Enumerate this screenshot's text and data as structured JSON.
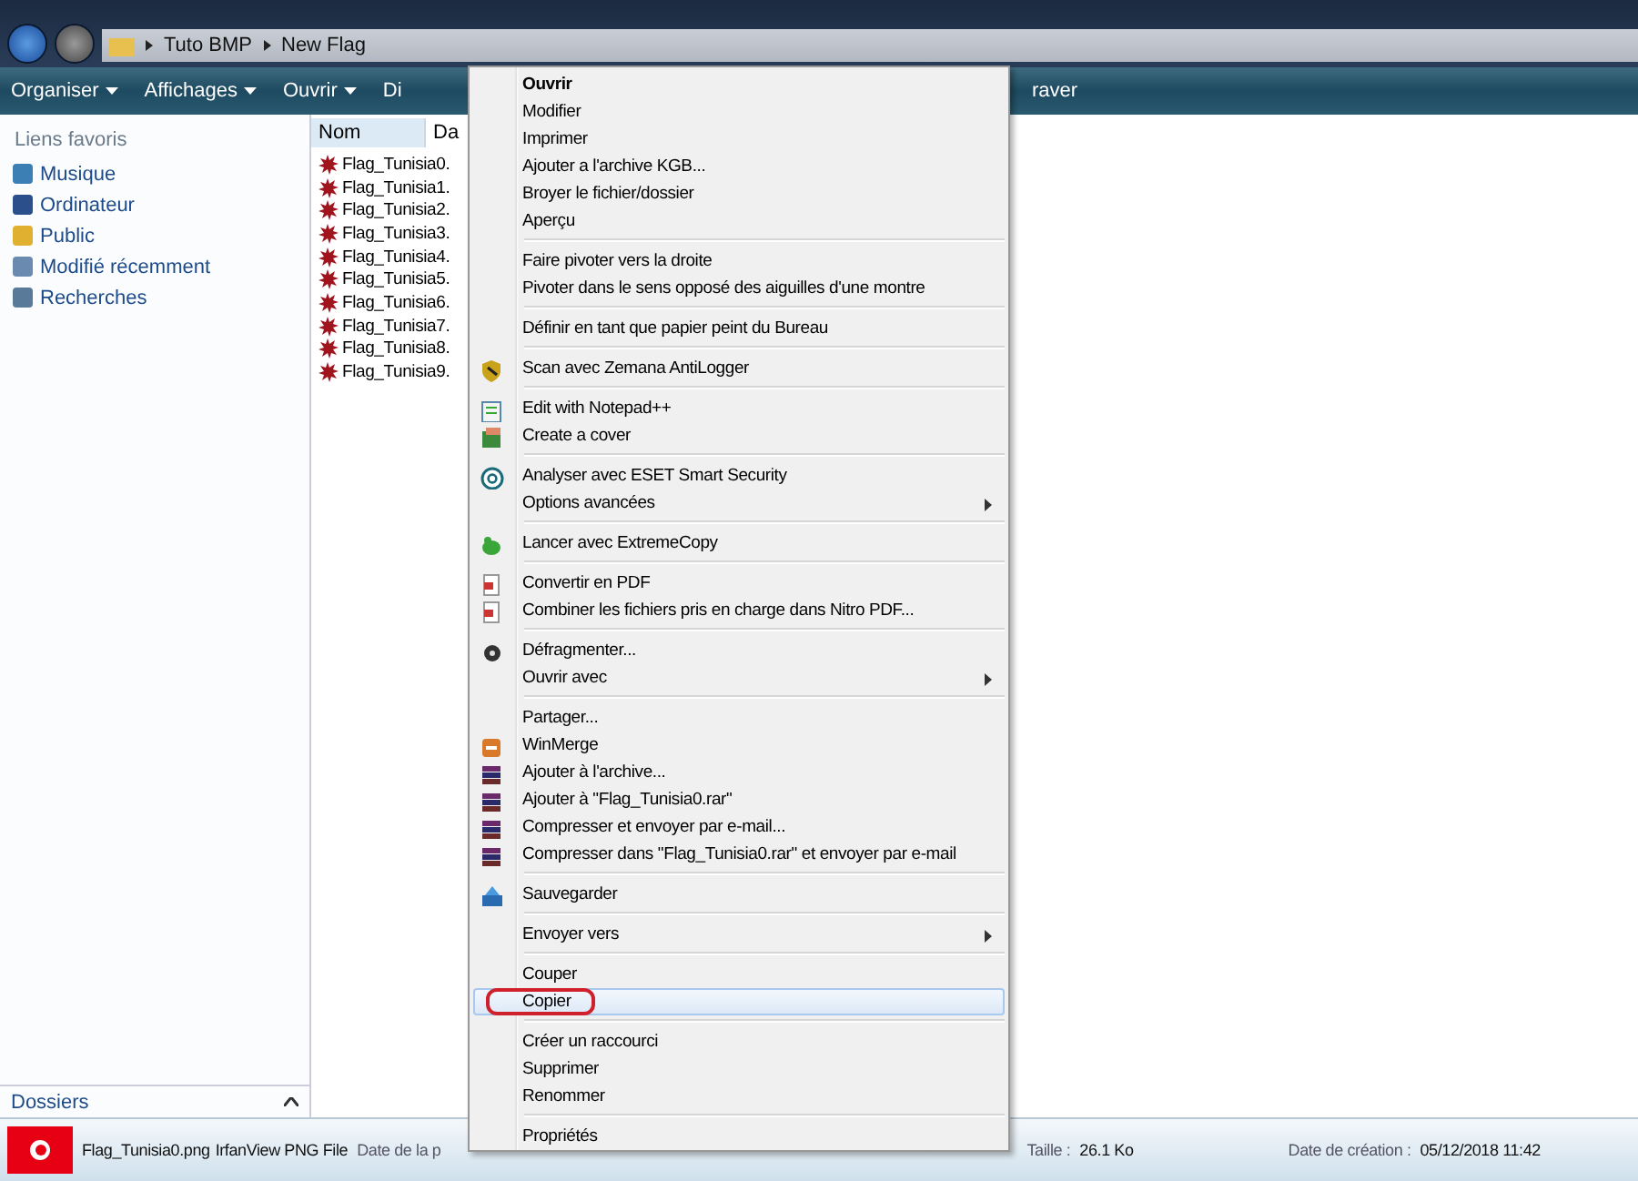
{
  "address_bar": {
    "crumbs": [
      "Tuto BMP",
      "New Flag"
    ]
  },
  "toolbar": {
    "items": [
      {
        "label": "Organiser",
        "kind": "dropdown"
      },
      {
        "label": "Affichages",
        "kind": "dropdown"
      },
      {
        "label": "Ouvrir",
        "kind": "dropdown"
      },
      {
        "label": "Di",
        "kind": "plain"
      }
    ],
    "trailing": "raver"
  },
  "sidebar": {
    "heading": "Liens favoris",
    "items": [
      {
        "label": "Musique"
      },
      {
        "label": "Ordinateur"
      },
      {
        "label": "Public"
      },
      {
        "label": "Modifié récemment"
      },
      {
        "label": "Recherches"
      }
    ],
    "folders": "Dossiers"
  },
  "file_list": {
    "columns": [
      "Nom",
      "Da"
    ],
    "files": [
      "Flag_Tunisia0.",
      "Flag_Tunisia1.",
      "Flag_Tunisia2.",
      "Flag_Tunisia3.",
      "Flag_Tunisia4.",
      "Flag_Tunisia5.",
      "Flag_Tunisia6.",
      "Flag_Tunisia7.",
      "Flag_Tunisia8.",
      "Flag_Tunisia9."
    ]
  },
  "context_menu": {
    "items": [
      {
        "kind": "item",
        "label": "Ouvrir",
        "bold": true,
        "icon": false,
        "submenu": false,
        "selected": false
      },
      {
        "kind": "item",
        "label": "Modifier",
        "bold": false,
        "icon": false,
        "submenu": false,
        "selected": false
      },
      {
        "kind": "item",
        "label": "Imprimer",
        "bold": false,
        "icon": false,
        "submenu": false,
        "selected": false
      },
      {
        "kind": "item",
        "label": "Ajouter a l'archive KGB...",
        "bold": false,
        "icon": false,
        "submenu": false,
        "selected": false
      },
      {
        "kind": "item",
        "label": "Broyer le fichier/dossier",
        "bold": false,
        "icon": false,
        "submenu": false,
        "selected": false
      },
      {
        "kind": "item",
        "label": "Aperçu",
        "bold": false,
        "icon": false,
        "submenu": false,
        "selected": false
      },
      {
        "kind": "separator"
      },
      {
        "kind": "item",
        "label": "Faire pivoter vers la droite",
        "bold": false,
        "icon": false,
        "submenu": false,
        "selected": false
      },
      {
        "kind": "item",
        "label": "Pivoter dans le sens opposé des aiguilles d'une montre",
        "bold": false,
        "icon": false,
        "submenu": false,
        "selected": false
      },
      {
        "kind": "separator"
      },
      {
        "kind": "item",
        "label": "Définir en tant que papier peint du Bureau",
        "bold": false,
        "icon": false,
        "submenu": false,
        "selected": false
      },
      {
        "kind": "separator"
      },
      {
        "kind": "item",
        "label": "Scan avec Zemana AntiLogger",
        "bold": false,
        "icon": true,
        "submenu": false,
        "selected": false
      },
      {
        "kind": "separator"
      },
      {
        "kind": "item",
        "label": "Edit with Notepad++",
        "bold": false,
        "icon": true,
        "submenu": false,
        "selected": false
      },
      {
        "kind": "item",
        "label": "Create a cover",
        "bold": false,
        "icon": true,
        "submenu": false,
        "selected": false
      },
      {
        "kind": "separator"
      },
      {
        "kind": "item",
        "label": "Analyser avec ESET Smart Security",
        "bold": false,
        "icon": true,
        "submenu": false,
        "selected": false
      },
      {
        "kind": "item",
        "label": "Options avancées",
        "bold": false,
        "icon": false,
        "submenu": true,
        "selected": false
      },
      {
        "kind": "separator"
      },
      {
        "kind": "item",
        "label": "Lancer avec ExtremeCopy",
        "bold": false,
        "icon": true,
        "submenu": false,
        "selected": false
      },
      {
        "kind": "separator"
      },
      {
        "kind": "item",
        "label": "Convertir en PDF",
        "bold": false,
        "icon": true,
        "submenu": false,
        "selected": false
      },
      {
        "kind": "item",
        "label": "Combiner les fichiers pris en charge dans Nitro PDF...",
        "bold": false,
        "icon": true,
        "submenu": false,
        "selected": false
      },
      {
        "kind": "separator"
      },
      {
        "kind": "item",
        "label": "Défragmenter...",
        "bold": false,
        "icon": true,
        "submenu": false,
        "selected": false
      },
      {
        "kind": "item",
        "label": "Ouvrir avec",
        "bold": false,
        "icon": false,
        "submenu": true,
        "selected": false
      },
      {
        "kind": "separator"
      },
      {
        "kind": "item",
        "label": "Partager...",
        "bold": false,
        "icon": false,
        "submenu": false,
        "selected": false
      },
      {
        "kind": "item",
        "label": "WinMerge",
        "bold": false,
        "icon": true,
        "submenu": false,
        "selected": false
      },
      {
        "kind": "item",
        "label": "Ajouter à l'archive...",
        "bold": false,
        "icon": true,
        "submenu": false,
        "selected": false
      },
      {
        "kind": "item",
        "label": "Ajouter à \"Flag_Tunisia0.rar\"",
        "bold": false,
        "icon": true,
        "submenu": false,
        "selected": false
      },
      {
        "kind": "item",
        "label": "Compresser et envoyer par e-mail...",
        "bold": false,
        "icon": true,
        "submenu": false,
        "selected": false
      },
      {
        "kind": "item",
        "label": "Compresser dans \"Flag_Tunisia0.rar\" et envoyer par e-mail",
        "bold": false,
        "icon": true,
        "submenu": false,
        "selected": false
      },
      {
        "kind": "separator"
      },
      {
        "kind": "item",
        "label": "Sauvegarder",
        "bold": false,
        "icon": true,
        "submenu": false,
        "selected": false
      },
      {
        "kind": "separator"
      },
      {
        "kind": "item",
        "label": "Envoyer vers",
        "bold": false,
        "icon": false,
        "submenu": true,
        "selected": false
      },
      {
        "kind": "separator"
      },
      {
        "kind": "item",
        "label": "Couper",
        "bold": false,
        "icon": false,
        "submenu": false,
        "selected": false
      },
      {
        "kind": "item",
        "label": "Copier",
        "bold": false,
        "icon": false,
        "submenu": false,
        "selected": true
      },
      {
        "kind": "separator"
      },
      {
        "kind": "item",
        "label": "Créer un raccourci",
        "bold": false,
        "icon": false,
        "submenu": false,
        "selected": false
      },
      {
        "kind": "item",
        "label": "Supprimer",
        "bold": false,
        "icon": false,
        "submenu": false,
        "selected": false
      },
      {
        "kind": "item",
        "label": "Renommer",
        "bold": false,
        "icon": false,
        "submenu": false,
        "selected": false
      },
      {
        "kind": "separator"
      },
      {
        "kind": "item",
        "label": "Propriétés",
        "bold": false,
        "icon": false,
        "submenu": false,
        "selected": false
      }
    ]
  },
  "details_pane": {
    "file_name": "Flag_Tunisia0.png",
    "file_type": "IrfanView PNG File",
    "date_label": "Date de la p",
    "size_label": "Taille :",
    "size": "26.1 Ko",
    "created_label": "Date de création :",
    "created": "05/12/2018 11:42"
  }
}
